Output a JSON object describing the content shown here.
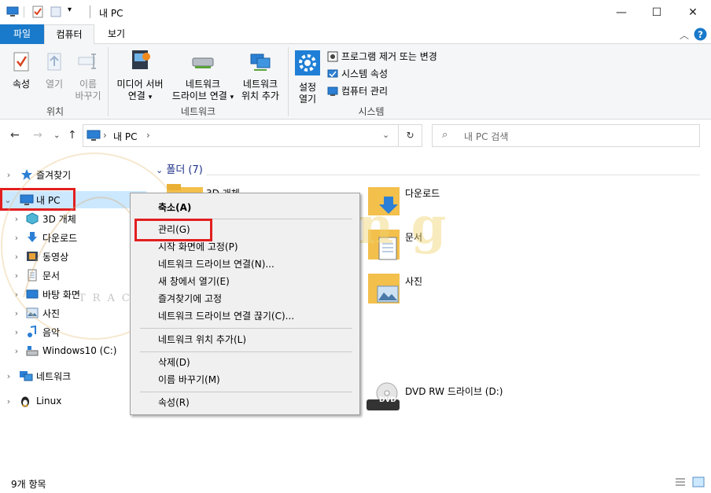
{
  "window": {
    "title": "내 PC",
    "minimize": "—",
    "maximize": "☐",
    "close": "✕"
  },
  "tabs": {
    "file": "파일",
    "computer": "컴퓨터",
    "view": "보기"
  },
  "ribbon": {
    "properties": "속성",
    "open": "열기",
    "rename_1": "이름",
    "rename_2": "바꾸기",
    "group_location": "위치",
    "media_1": "미디어 서버",
    "media_2": "연결",
    "map_drive_1": "네트워크",
    "map_drive_2": "드라이브 연결",
    "add_location_1": "네트워크",
    "add_location_2": "위치 추가",
    "group_network": "네트워크",
    "settings_1": "설정",
    "settings_2": "열기",
    "uninstall": "프로그램 제거 또는 변경",
    "system_props": "시스템 속성",
    "manage": "컴퓨터 관리",
    "group_system": "시스템"
  },
  "address": {
    "path": "내 PC",
    "search_placeholder": "내 PC 검색"
  },
  "nav": {
    "quick_access": "즐겨찾기",
    "this_pc": "내 PC",
    "objects3d": "3D 개체",
    "downloads": "다운로드",
    "videos": "동영상",
    "documents": "문서",
    "desktop": "바탕 화면",
    "pictures": "사진",
    "music": "음악",
    "cdrive": "Windows10 (C:)",
    "network": "네트워크",
    "linux": "Linux"
  },
  "content": {
    "folders_header": "폴더 (7)",
    "f_3d": "3D 개체",
    "f_downloads": "다운로드",
    "f_documents": "문서",
    "f_pictures": "사진",
    "dvd": "DVD RW 드라이브 (D:)",
    "dvd_label": "DVD"
  },
  "context_menu": {
    "collapse": "축소(A)",
    "manage": "관리(G)",
    "pin_start": "시작 화면에 고정(P)",
    "map_drive": "네트워크 드라이브 연결(N)...",
    "open_new": "새 창에서 열기(E)",
    "pin_quick": "즐겨찾기에 고정",
    "disconnect": "네트워크 드라이브 연결 끊기(C)...",
    "add_location": "네트워크 위치 추가(L)",
    "delete": "삭제(D)",
    "rename": "이름 바꾸기(M)",
    "properties": "속성(R)"
  },
  "status": {
    "count": "9개 항목"
  },
  "watermark": {
    "main": "King",
    "sub": "TRACES OF"
  },
  "colors": {
    "accent": "#1979ca",
    "highlight": "#e21f1f",
    "selected": "#cce8ff"
  }
}
